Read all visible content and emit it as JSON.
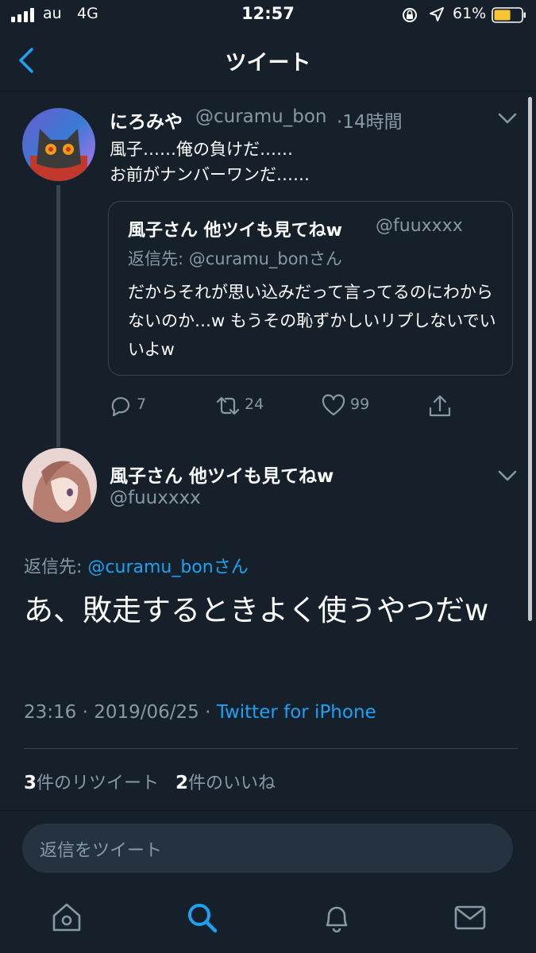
{
  "status_bar": {
    "carrier": "au",
    "network": "4G",
    "time": "12:57",
    "battery": "61%",
    "battery_level": 0.61
  },
  "header": {
    "title": "ツイート"
  },
  "tweet1": {
    "name": "にろみや",
    "handle": "@curamu_bon",
    "time": "·14時間",
    "text_line1": "風子……俺の負けだ……",
    "text_line2": "お前がナンバーワンだ……",
    "quote": {
      "name": "風子さん 他ツイも見てねw",
      "handle": "@fuuxxxx",
      "reply_to": "返信先: @curamu_bonさん",
      "text": "だからそれが思い込みだって言ってるのにわからないのか…w もうその恥ずかしいリプしないでいいよw"
    },
    "actions": {
      "replies": "7",
      "retweets": "24",
      "likes": "99"
    }
  },
  "tweet2": {
    "name": "風子さん 他ツイも見てねw",
    "handle": "@fuuxxxx",
    "reply_prefix": "返信先: ",
    "reply_user": "@curamu_bonさん",
    "text": "あ、敗走するときよく使うやつだw",
    "timestamp": "23:16 · 2019/06/25 · ",
    "source": "Twitter for iPhone",
    "retweet_count": "3",
    "retweet_label": "件のリツイート",
    "like_count": "2",
    "like_label": "件のいいね"
  },
  "reply_box": {
    "placeholder": "返信をツイート"
  },
  "tab_bar": [
    "home-icon",
    "search-icon",
    "notifications-icon",
    "messages-icon"
  ],
  "colors": {
    "background": "#15202b",
    "accent": "#1da1f2",
    "secondary_text": "#8899a6"
  }
}
